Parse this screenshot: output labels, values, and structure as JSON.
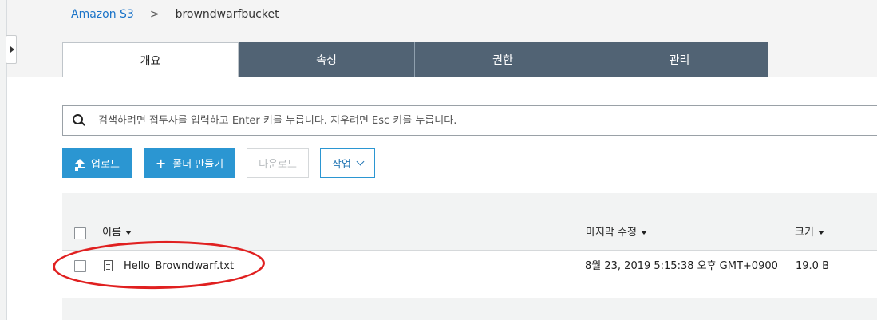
{
  "breadcrumb": {
    "root": "Amazon S3",
    "separator": ">",
    "current": "browndwarfbucket"
  },
  "tabs": [
    {
      "label": "개요",
      "active": true
    },
    {
      "label": "속성",
      "active": false
    },
    {
      "label": "권한",
      "active": false
    },
    {
      "label": "관리",
      "active": false
    }
  ],
  "search": {
    "placeholder": "검색하려면 접두사를 입력하고 Enter 키를 누릅니다. 지우려면 Esc 키를 누릅니다."
  },
  "toolbar": {
    "upload_label": "업로드",
    "folder_label": "폴더 만들기",
    "download_label": "다운로드",
    "actions_label": "작업"
  },
  "table": {
    "columns": {
      "name": "이름",
      "modified": "마지막 수정",
      "size": "크기"
    },
    "rows": [
      {
        "name": "Hello_Browndwarf.txt",
        "modified": "8월 23, 2019 5:15:38 오후 GMT+0900",
        "size": "19.0 B"
      }
    ]
  },
  "colors": {
    "tab_bg": "#516374",
    "primary_button": "#2b96d2",
    "link": "#1a73c8",
    "annotation": "#e02020"
  }
}
